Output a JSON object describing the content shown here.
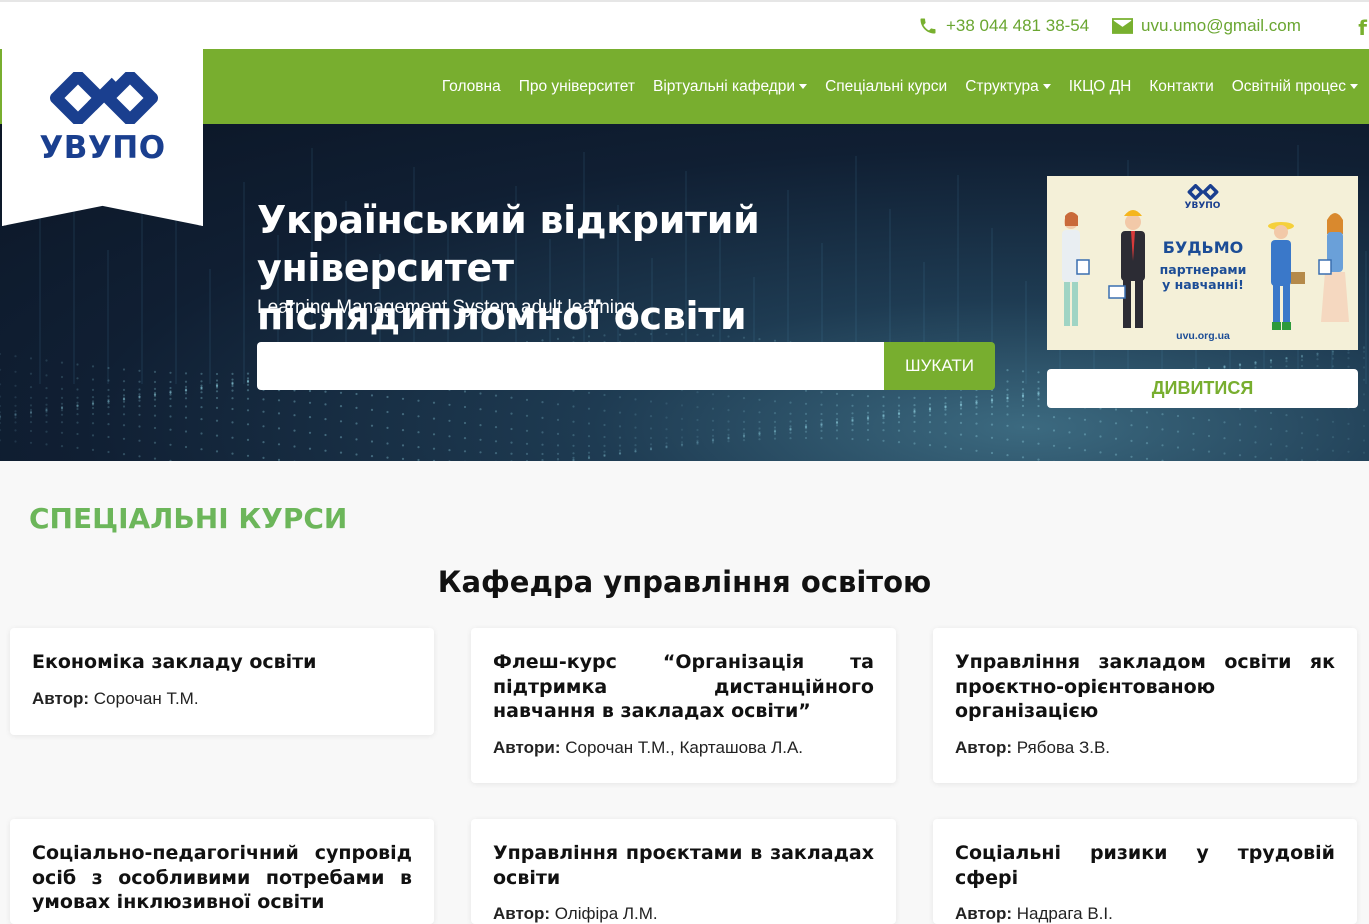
{
  "topbar": {
    "phone": "+38 044 481 38-54",
    "email": "uvu.umo@gmail.com",
    "social": "f"
  },
  "logo": {
    "text": "УВУПО"
  },
  "nav": {
    "items": [
      {
        "label": "Головна",
        "dropdown": false
      },
      {
        "label": "Про університет",
        "dropdown": false
      },
      {
        "label": "Віртуальні кафедри",
        "dropdown": true
      },
      {
        "label": "Спеціальні курси",
        "dropdown": false
      },
      {
        "label": "Структура",
        "dropdown": true
      },
      {
        "label": "ІКЦО ДН",
        "dropdown": false
      },
      {
        "label": "Контакти",
        "dropdown": false
      },
      {
        "label": "Освітній процес",
        "dropdown": true
      }
    ]
  },
  "hero": {
    "title_line1": "Український відкритий університет",
    "title_line2": "післядипломної освіти",
    "subtitle": "Learning Management System adult learning",
    "search_value": "",
    "search_button": "ШУКАТИ"
  },
  "banner": {
    "logo_text": "УВУПО",
    "headline": "БУДЬМО",
    "line1": "партнерами",
    "line2": "у навчанні!",
    "url": "uvu.org.ua",
    "button": "ДИВИТИСЯ"
  },
  "section": {
    "title": "СПЕЦІАЛЬНІ КУРСИ",
    "department": "Кафедра управління освітою",
    "cards": [
      {
        "title": "Економіка закладу освіти",
        "author_label": "Автор:",
        "author": " Сорочан Т.М."
      },
      {
        "title": "Флеш-курс “Організація та підтримка дистанційного навчання в закладах освіти”",
        "author_label": "Автори:",
        "author": " Сорочан Т.М., Карташова Л.А."
      },
      {
        "title": "Управління закладом освіти як проєктно-орієнтованою організацією",
        "author_label": "Автор:",
        "author": " Рябова З.В."
      },
      {
        "title": "Соціально-педагогічний супровід осіб з особливими потребами в умовах інклюзивної освіти",
        "author_label": "",
        "author": ""
      },
      {
        "title": "Управління проєктами в закладах освіти",
        "author_label": "Автор:",
        "author": " Оліфіра Л.М."
      },
      {
        "title": "Соціальні ризики у трудовій сфері",
        "author_label": "Автор:",
        "author": " Надрага В.І."
      }
    ]
  },
  "colors": {
    "green": "#78ae2f",
    "section_green": "#6cb65a",
    "logo_blue": "#1a3f8f"
  }
}
